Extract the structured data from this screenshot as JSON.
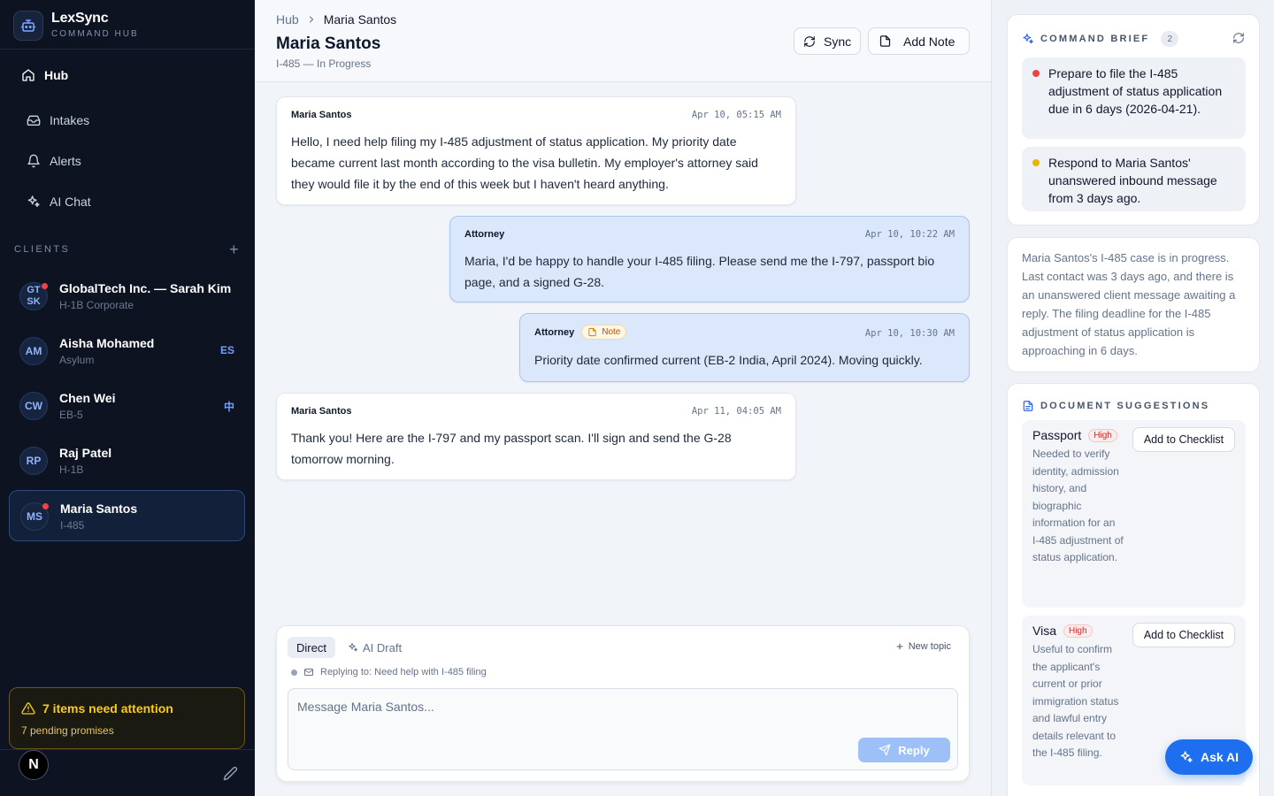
{
  "brand": {
    "title": "LexSync",
    "subtitle": "COMMAND HUB"
  },
  "nav": [
    {
      "label": "Hub",
      "icon": "home-icon",
      "active": true
    },
    {
      "label": "Intakes",
      "icon": "inbox-icon"
    },
    {
      "label": "Alerts",
      "icon": "bell-icon"
    },
    {
      "label": "AI Chat",
      "icon": "sparkles-icon"
    }
  ],
  "clients_header": {
    "label": "CLIENTS",
    "add": "+"
  },
  "clients": [
    {
      "initials_top": "GT",
      "initials_bottom": "SK",
      "name": "GlobalTech Inc. — Sarah Kim",
      "sub": "H-1B Corporate",
      "lang": "",
      "unread": true
    },
    {
      "initials": "AM",
      "name": "Aisha Mohamed",
      "sub": "Asylum",
      "lang": "ES"
    },
    {
      "initials": "CW",
      "name": "Chen Wei",
      "sub": "EB-5",
      "lang": "中"
    },
    {
      "initials": "RP",
      "name": "Raj Patel",
      "sub": "H-1B",
      "lang": ""
    },
    {
      "initials": "MS",
      "name": "Maria Santos",
      "sub": "I-485",
      "lang": "",
      "unread": true,
      "active": true
    }
  ],
  "attention": {
    "title": "7 items need attention",
    "sub": "7 pending promises"
  },
  "footer": {
    "badge": "N"
  },
  "header": {
    "breadcrumb_root": "Hub",
    "breadcrumb_current": "Maria Santos",
    "title": "Maria Santos",
    "subtitle": "I-485 — In Progress",
    "sync_label": "Sync",
    "add_note_label": "Add Note"
  },
  "messages": [
    {
      "author": "Maria Santos",
      "time": "Apr 10, 05:15 AM",
      "text": "Hello, I need help filing my I-485 adjustment of status application. My priority date became current last month according to the visa bulletin. My employer's attorney said they would file it by the end of this week but I haven't heard anything.",
      "direction": "in"
    },
    {
      "author": "Attorney",
      "time": "Apr 10, 10:22 AM",
      "text": "Maria, I'd be happy to handle your I-485 filing. Please send me the I-797, passport bio page, and a signed G-28.",
      "direction": "out"
    },
    {
      "author": "Attorney",
      "tag": "Note",
      "time": "Apr 10, 10:30 AM",
      "text": "Priority date confirmed current (EB-2 India, April 2024). Moving quickly.",
      "direction": "out"
    },
    {
      "author": "Maria Santos",
      "time": "Apr 11, 04:05 AM",
      "text": "Thank you! Here are the I-797 and my passport scan. I'll sign and send the G-28 tomorrow morning.",
      "direction": "in"
    }
  ],
  "composer": {
    "tab_direct": "Direct",
    "tab_ai_draft": "AI Draft",
    "new_topic": "New topic",
    "replying": "Replying to: Need help with I-485 filing",
    "placeholder": "Message Maria Santos...",
    "reply_label": "Reply"
  },
  "brief": {
    "title": "COMMAND BRIEF",
    "count": "2",
    "items": [
      {
        "text": "Prepare to file the I-485 adjustment of status application due in 6 days (2026-04-21).",
        "color": "#ef4444"
      },
      {
        "text": "Respond to Maria Santos' unanswered inbound message from 3 days ago.",
        "color": "#eab308"
      }
    ]
  },
  "summary": "Maria Santos's I-485 case is in progress. Last contact was 3 days ago, and there is an unanswered client message awaiting a reply. The filing deadline for the I-485 adjustment of status application is approaching in 6 days.",
  "documents": {
    "title": "DOCUMENT SUGGESTIONS",
    "items": [
      {
        "name": "Passport",
        "priority": "High",
        "desc": "Needed to verify identity, admission history, and biographic information for an I-485 adjustment of status application.",
        "button": "Add to Checklist"
      },
      {
        "name": "Visa",
        "priority": "High",
        "desc": "Useful to confirm the applicant's current or prior immigration status and lawful entry details relevant to the I-485 filing.",
        "button": "Add to Checklist"
      }
    ]
  },
  "ask_ai": "Ask AI",
  "colors": {
    "accent": "#1d6ff0",
    "sidebar_bg": "#0d1321",
    "warning": "#facc15",
    "danger": "#ef4444"
  }
}
